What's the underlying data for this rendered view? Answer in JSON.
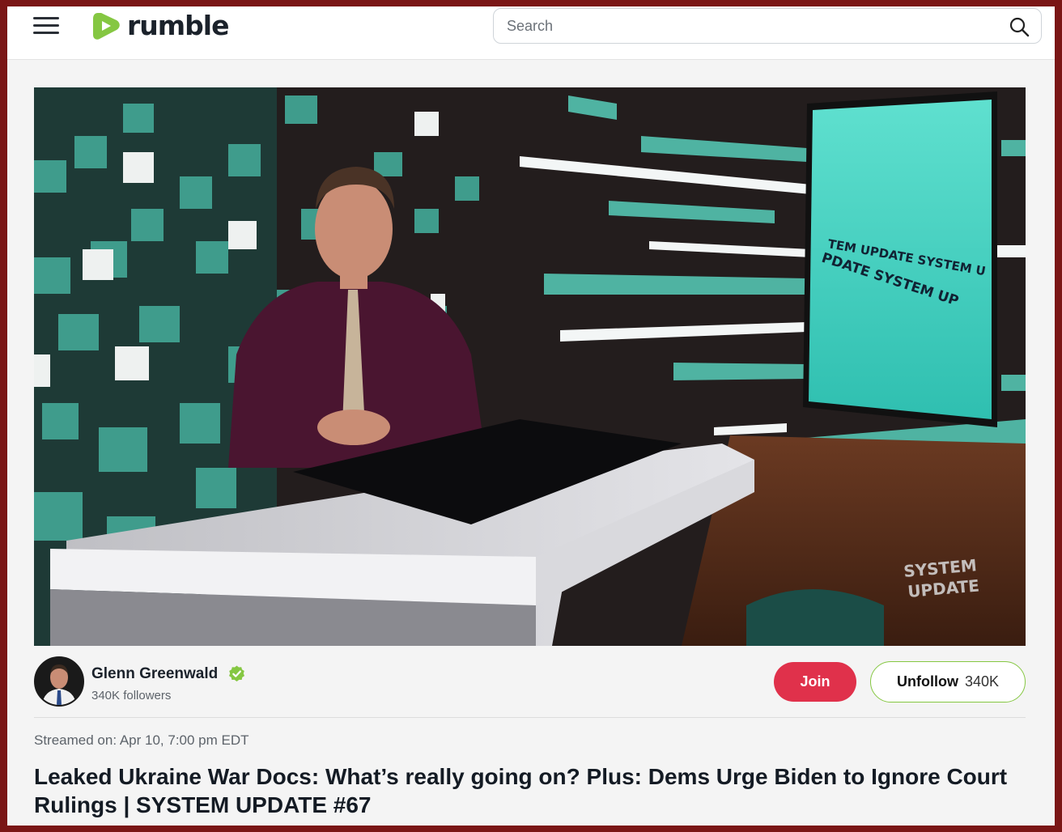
{
  "brand": {
    "name": "rumble",
    "logo_color": "#85c742"
  },
  "header": {
    "menu_icon": "hamburger-icon",
    "search": {
      "placeholder": "Search",
      "value": "",
      "icon": "search-icon"
    }
  },
  "video": {
    "thumbnail": "studio-host-at-desk",
    "watermark_line1": "SYSTEM",
    "watermark_line2": "UPDATE",
    "screen_text": "UPDATE SYSTEM UPDATE SYSTEM"
  },
  "channel": {
    "name": "Glenn Greenwald",
    "verified_icon": "verified-check-icon",
    "followers": "340K followers",
    "join_label": "Join",
    "unfollow_label": "Unfollow",
    "unfollow_count": "340K"
  },
  "meta": {
    "streamed_on": "Streamed on: Apr 10, 7:00 pm EDT",
    "title": "Leaked Ukraine War Docs: What’s really going on? Plus: Dems Urge Biden to Ignore Court Rulings | SYSTEM UPDATE #67"
  },
  "colors": {
    "accent_green": "#85c742",
    "join_red": "#e0314b",
    "frame_border": "#7a1616",
    "studio_teal": "#4fb3a2"
  }
}
